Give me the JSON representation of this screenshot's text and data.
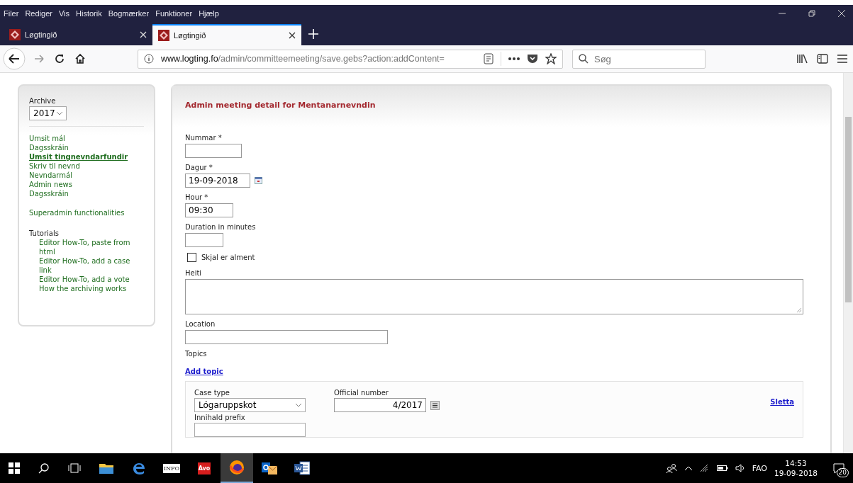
{
  "menu_bar": [
    "Filer",
    "Rediger",
    "Vis",
    "Historik",
    "Bogmærker",
    "Funktioner",
    "Hjælp"
  ],
  "tabs": [
    {
      "label": "Løgtingið",
      "selected": false
    },
    {
      "label": "Løgtingið",
      "selected": true
    }
  ],
  "address_bar": {
    "host": "www.logting.fo",
    "path": "/admin/committeemeeting/save.gebs?action:addContent="
  },
  "search": {
    "placeholder": "Søg"
  },
  "sidebar": {
    "archive_label": "Archive",
    "archive_year": "2017",
    "items": [
      {
        "label": "Umsit mál",
        "selected": false
      },
      {
        "label": "Dagsskráin",
        "selected": false
      },
      {
        "label": "Umsit tingnevndarfundir",
        "selected": true
      },
      {
        "label": "Skriv til nevnd",
        "selected": false
      },
      {
        "label": "Nevndarmál",
        "selected": false
      },
      {
        "label": "Admin news",
        "selected": false
      },
      {
        "label": "Dagsskráin",
        "selected": false
      }
    ],
    "superadmin": "Superadmin functionalities",
    "tutorials_heading": "Tutorials",
    "tutorials": [
      "Editor How-To, paste from html",
      "Editor How-To, add a case link",
      "Editor How-To, add a vote",
      "How the archiving works"
    ]
  },
  "main": {
    "title": "Admin meeting detail for Mentanarnevndin",
    "fields": [
      {
        "kind": "text",
        "label": "Nummar *"
      },
      {
        "kind": "date",
        "label": "Dagur *",
        "value": "19-09-2018"
      },
      {
        "kind": "text",
        "label": "Hour *",
        "value": "09:30"
      },
      {
        "kind": "text",
        "label": "Duration in minutes"
      },
      {
        "kind": "checkbox",
        "label": "Skjal er alment",
        "checked": false
      },
      {
        "kind": "textarea",
        "label": "Heiti"
      },
      {
        "kind": "text",
        "label": "Location"
      }
    ],
    "topics_label": "Topics",
    "add_topic": "Add topic",
    "topic": {
      "case_type_label": "Case type",
      "case_type": "Lógaruppskot",
      "official_number_label": "Official number",
      "official_number": "4/2017",
      "delete": "Sletta",
      "prefix_label": "Innihald prefix"
    }
  },
  "taskbar": {
    "apps": [
      {
        "kind": "explorer",
        "selected": false
      },
      {
        "kind": "edge",
        "selected": false
      },
      {
        "kind": "info",
        "label": "INFO",
        "selected": false
      },
      {
        "kind": "avo",
        "label": "Avo",
        "selected": false
      },
      {
        "kind": "firefox",
        "selected": true
      },
      {
        "kind": "outlook",
        "selected": false
      },
      {
        "kind": "word",
        "selected": false
      }
    ],
    "language": "FAO",
    "time": "14:53",
    "date": "19-09-2018",
    "notifications": "20"
  }
}
